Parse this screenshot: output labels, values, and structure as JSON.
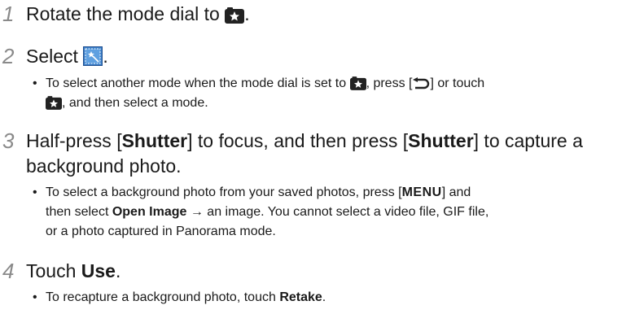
{
  "steps": [
    {
      "number": "1",
      "text_before": "Rotate the mode dial to",
      "text_after": "."
    },
    {
      "number": "2",
      "text_before": "Select",
      "text_after": ".",
      "bullets": [
        {
          "l1_before": "To select another mode when the mode dial is set to",
          "l1_mid": ", press [",
          "l1_after": "] or touch",
          "l2": ", and then select a mode."
        }
      ]
    },
    {
      "number": "3",
      "line1_a": "Half-press [",
      "line1_b": "Shutter",
      "line1_c": "] to focus, and then press [",
      "line1_d": "Shutter",
      "line1_e": "] to capture a",
      "line2": "background photo.",
      "bullets": [
        {
          "l1_before": "To select a background photo from your saved photos, press [",
          "l1_key": "MENU",
          "l1_after": "] and",
          "l2_before": "then select ",
          "l2_bold": "Open Image",
          "l2_after": " → an image. You cannot select a video file, GIF file,",
          "l3": "or a photo captured in Panorama mode."
        }
      ]
    },
    {
      "number": "4",
      "text_before": "Touch ",
      "text_bold": "Use",
      "text_after": ".",
      "bullets": [
        {
          "before": "To recapture a background photo, touch ",
          "bold": "Retake",
          "after": "."
        }
      ]
    }
  ],
  "bullet_char": "•",
  "icons": {
    "mode_dial": "star-mode-icon",
    "frame_mode": "magic-frame-icon",
    "back": "back-arrow-icon"
  },
  "colors": {
    "step_number": "#8a8a8a",
    "text": "#1a1a1a",
    "icon_bg": "#222222"
  }
}
